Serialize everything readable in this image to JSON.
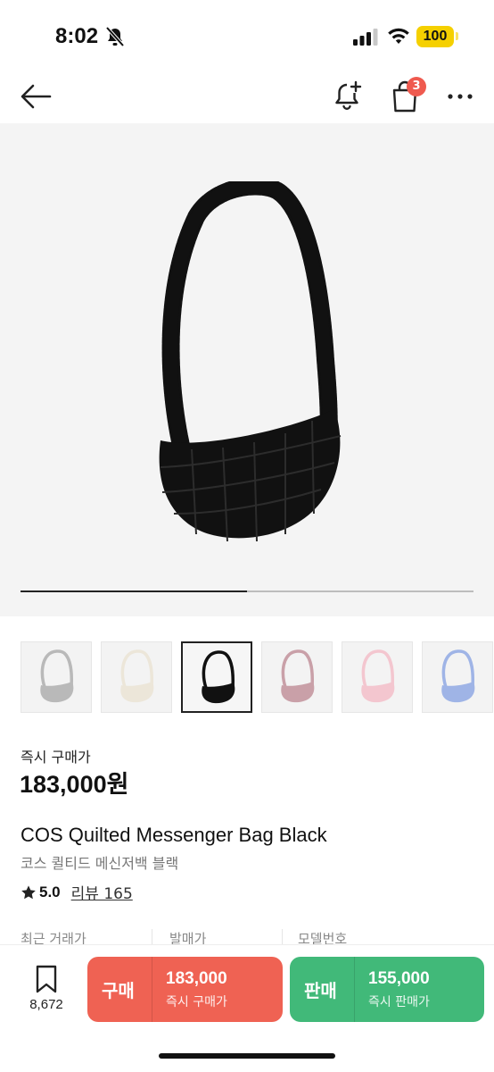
{
  "status_bar": {
    "time": "8:02",
    "battery": "100"
  },
  "nav": {
    "back_icon": "arrow-left-icon",
    "alarm_icon": "bell-plus-icon",
    "cart_icon": "shopping-bag-icon",
    "cart_badge": "3",
    "more_icon": "more-horizontal-icon"
  },
  "gallery": {
    "current_image_progress": 0.5,
    "thumbnails": [
      {
        "color_name": "grey",
        "color": "#b9b9b9"
      },
      {
        "color_name": "ivory",
        "color": "#ece6d9"
      },
      {
        "color_name": "black",
        "color": "#111111",
        "selected": true
      },
      {
        "color_name": "dusty-pink",
        "color": "#c9a0a8"
      },
      {
        "color_name": "light-pink",
        "color": "#f3c6cf"
      },
      {
        "color_name": "light-blue",
        "color": "#9fb4e6"
      }
    ]
  },
  "product": {
    "instant_buy_label": "즉시 구매가",
    "price": "183,000원",
    "title_en": "COS Quilted Messenger Bag Black",
    "title_ko": "코스 퀼티드 메신저백 블랙",
    "rating": "5.0",
    "review_label": "리뷰 165"
  },
  "info_headers": {
    "recent_trade": "최근 거래가",
    "release_price": "발매가",
    "model_number": "모델번호"
  },
  "bottom_bar": {
    "wish_count": "8,672",
    "buy": {
      "label": "구매",
      "amount": "183,000",
      "sub": "즉시 구매가",
      "color": "#ef6253"
    },
    "sell": {
      "label": "판매",
      "amount": "155,000",
      "sub": "즉시 판매가",
      "color": "#41b979"
    }
  }
}
